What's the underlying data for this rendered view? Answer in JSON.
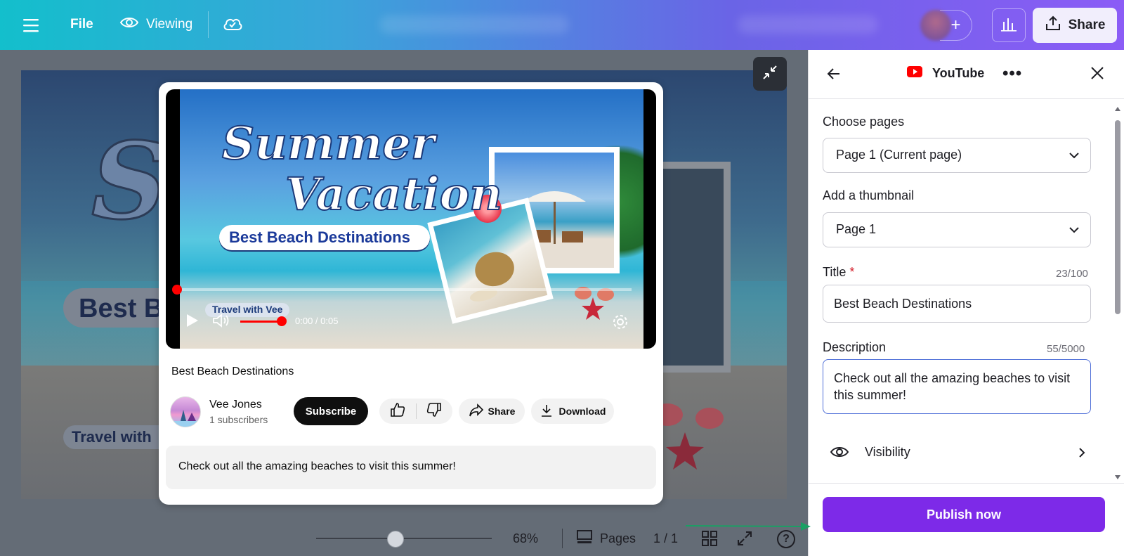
{
  "topbar": {
    "file_label": "File",
    "viewing_label": "Viewing",
    "share_label": "Share",
    "plus_label": "+"
  },
  "bottombar": {
    "zoom": "68%",
    "zoom_fraction": 0.45,
    "pages_label": "Pages",
    "page_count": "1 / 1",
    "help_label": "?"
  },
  "design": {
    "title_fragment": "Su",
    "pill1_fragment": "Best B",
    "pill2_fragment": "Travel with"
  },
  "preview": {
    "video": {
      "title_line1": "Summer",
      "title_line2": "Vacation",
      "subtitle": "Best Beach Destinations",
      "channel_tag": "Travel with Vee",
      "time": "0:00 / 0:05"
    },
    "title": "Best Beach Destinations",
    "channel_name": "Vee Jones",
    "subscribers": "1 subscribers",
    "subscribe_label": "Subscribe",
    "share_label": "Share",
    "download_label": "Download",
    "description": "Check out all the amazing beaches to visit this summer!"
  },
  "panel": {
    "header": {
      "title": "YouTube",
      "more_label": "•••"
    },
    "choose_pages": {
      "label": "Choose pages",
      "value": "Page 1 (Current page)"
    },
    "thumbnail": {
      "label": "Add a thumbnail",
      "value": "Page 1"
    },
    "title_field": {
      "label": "Title",
      "required_mark": "*",
      "counter": "23/100",
      "value": "Best Beach Destinations"
    },
    "description_field": {
      "label": "Description",
      "counter": "55/5000",
      "value": "Check out all the amazing beaches to visit this summer!"
    },
    "visibility_label": "Visibility",
    "publish_label": "Publish now"
  },
  "colors": {
    "accent_purple": "#7d2ae8",
    "youtube_red": "#ff0000",
    "annotation_arrow": "#1aa064"
  },
  "icons": [
    "menu-icon",
    "eye-icon",
    "cloud-check-icon",
    "insights-icon",
    "share-upload-icon",
    "collapse-icon",
    "back-arrow-icon",
    "youtube-icon",
    "close-icon",
    "chevron-down-icon",
    "chevron-right-icon",
    "play-icon",
    "volume-icon",
    "settings-gear-icon",
    "thumbs-up-icon",
    "thumbs-down-icon",
    "share-arrow-icon",
    "download-icon",
    "pages-icon",
    "grid-icon",
    "fullscreen-icon",
    "help-icon"
  ]
}
